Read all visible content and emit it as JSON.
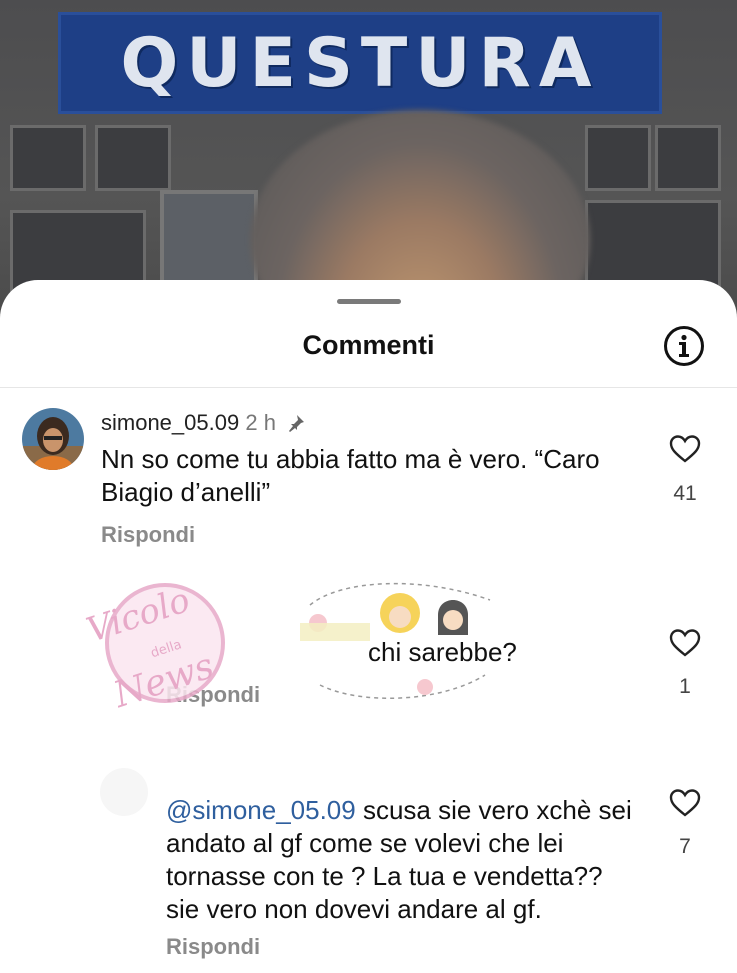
{
  "background": {
    "sign_text": "QUESTURA",
    "sign_color": "#1e3f86"
  },
  "sheet": {
    "title": "Commenti",
    "info_icon": "info-circle-icon"
  },
  "comments": [
    {
      "username": "simone_05.09",
      "time": "2 h",
      "pinned": true,
      "text": "Nn so come tu abbia fatto ma è vero. “Caro Biagio d’anelli”",
      "reply_label": "Rispondi",
      "likes": "41"
    },
    {
      "username": "",
      "mention": "",
      "text": "chi sarebbe?",
      "reply_label": "Rispondi",
      "likes": "1"
    },
    {
      "username": "",
      "mention": "@simone_05.09",
      "text": " scusa sie vero xchè sei andato al gf come se volevi che lei tornasse con te ? La tua e vendetta?? sie vero non dovevi andare al gf.",
      "reply_label": "Rispondi",
      "likes": "7"
    }
  ],
  "watermark": {
    "line1": "Vicolo",
    "line2": "della",
    "line3": "News"
  },
  "colors": {
    "mention": "#2f5f9e",
    "watermark": "#e7a9c8"
  }
}
